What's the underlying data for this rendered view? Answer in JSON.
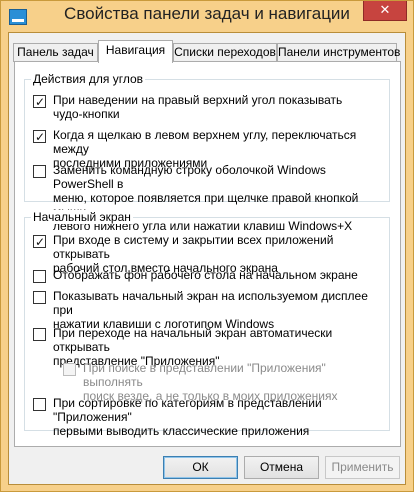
{
  "window": {
    "title": "Свойства панели задач и навигации",
    "close_label": "✕"
  },
  "tabs": [
    {
      "label": "Панель задач",
      "active": false
    },
    {
      "label": "Навигация",
      "active": true
    },
    {
      "label": "Списки переходов",
      "active": false
    },
    {
      "label": "Панели инструментов",
      "active": false
    }
  ],
  "corners_group": {
    "label": "Действия для углов",
    "options": [
      {
        "text": "При наведении на правый верхний угол показывать\nчудо-кнопки",
        "checked": true,
        "enabled": true
      },
      {
        "text": "Когда я щелкаю в левом верхнем углу, переключаться между\nпоследними приложениями",
        "checked": true,
        "enabled": true
      },
      {
        "text": "Заменить командную строку оболочкой Windows PowerShell в\nменю, которое появляется при щелчке правой кнопкой мыши\nлевого нижнего угла или нажатии клавиш Windows+X",
        "checked": false,
        "enabled": true
      }
    ]
  },
  "start_group": {
    "label": "Начальный экран",
    "options": [
      {
        "text": "При входе в систему и закрытии всех приложений открывать\nрабочий стол вместо начального экрана",
        "checked": true,
        "enabled": true
      },
      {
        "text": "Отображать фон рабочего стола на начальном экране",
        "checked": false,
        "enabled": true
      },
      {
        "text": "Показывать начальный экран на используемом дисплее при\nнажатии клавиши с логотипом Windows",
        "checked": false,
        "enabled": true
      },
      {
        "text": "При переходе на начальный экран автоматически открывать\nпредставление \"Приложения\"",
        "checked": false,
        "enabled": true
      },
      {
        "text": "При поиске в представлении \"Приложения\" выполнять\nпоиск везде, а не только в моих приложениях",
        "checked": false,
        "enabled": false
      },
      {
        "text": "При сортировке по категориям в представлении \"Приложения\"\nпервыми выводить классические приложения",
        "checked": false,
        "enabled": true
      }
    ]
  },
  "buttons": {
    "ok": "ОК",
    "cancel": "Отмена",
    "apply": "Применить"
  }
}
